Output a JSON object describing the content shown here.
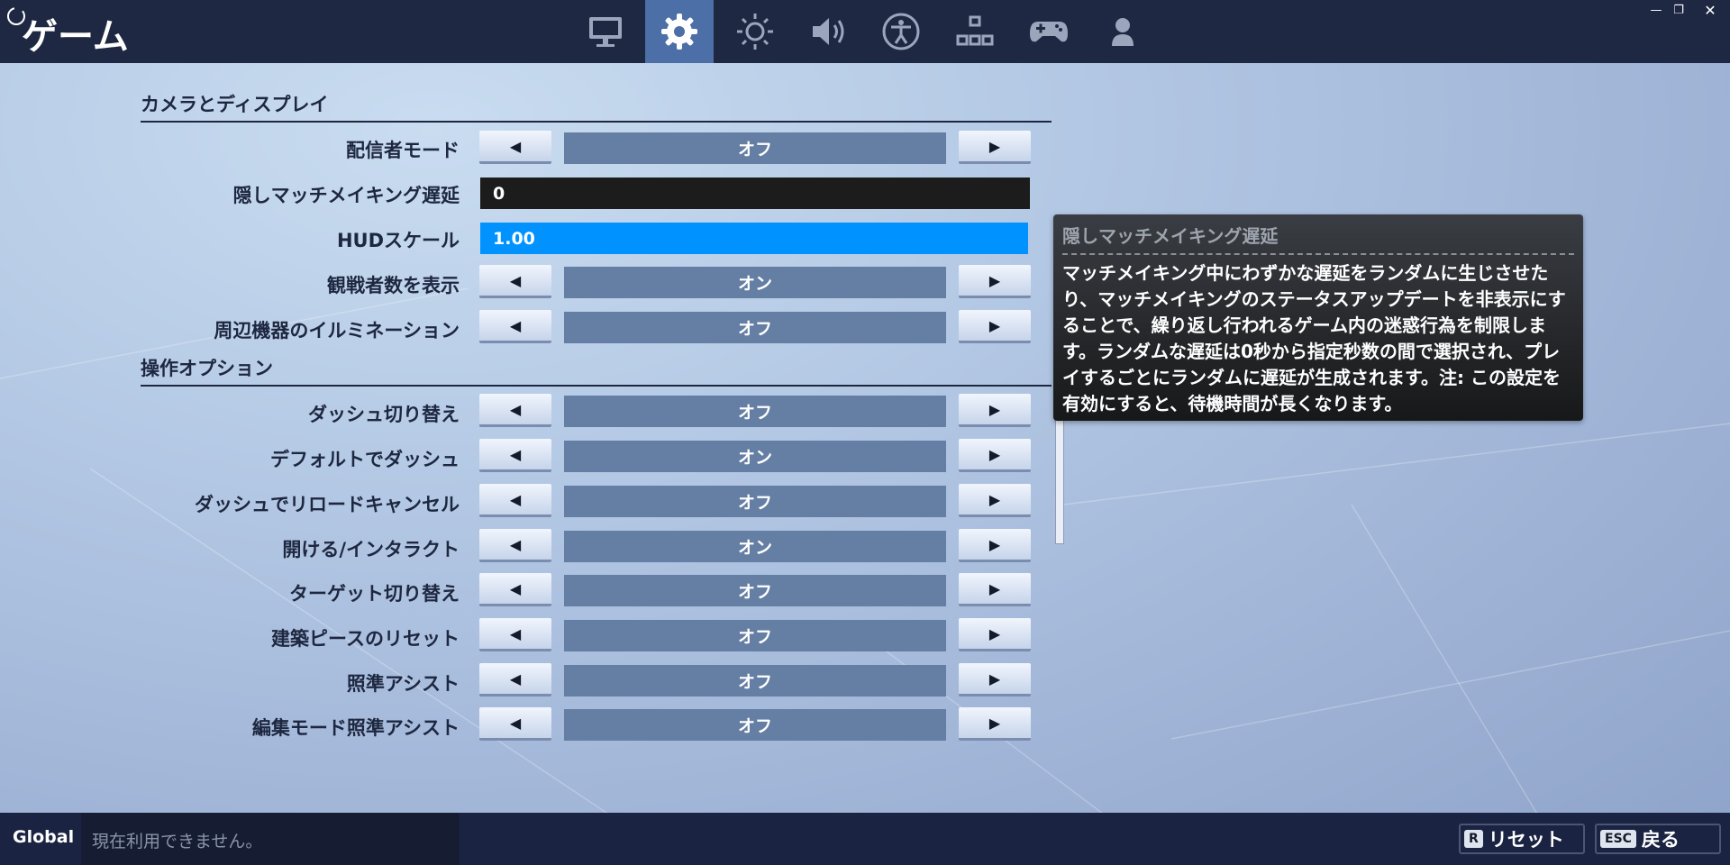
{
  "title": "ゲーム",
  "tabs": [
    {
      "icon": "monitor-icon",
      "active": false
    },
    {
      "icon": "gear-icon",
      "active": true
    },
    {
      "icon": "brightness-icon",
      "active": false
    },
    {
      "icon": "speaker-icon",
      "active": false
    },
    {
      "icon": "accessibility-icon",
      "active": false
    },
    {
      "icon": "input-tree-icon",
      "active": false
    },
    {
      "icon": "gamepad-icon",
      "active": false
    },
    {
      "icon": "account-icon",
      "active": false
    }
  ],
  "window": {
    "minimize": "—",
    "restore": "❐",
    "close": "✕"
  },
  "sections": {
    "camera": {
      "header": "カメラとディスプレイ",
      "rows": [
        {
          "label": "配信者モード",
          "value": "オフ"
        },
        {
          "label": "隠しマッチメイキング遅延",
          "value": "0"
        },
        {
          "label": "HUDスケール",
          "value": "1.00"
        },
        {
          "label": "観戦者数を表示",
          "value": "オン"
        },
        {
          "label": "周辺機器のイルミネーション",
          "value": "オフ"
        }
      ]
    },
    "controls": {
      "header": "操作オプション",
      "rows": [
        {
          "label": "ダッシュ切り替え",
          "value": "オフ"
        },
        {
          "label": "デフォルトでダッシュ",
          "value": "オン"
        },
        {
          "label": "ダッシュでリロードキャンセル",
          "value": "オフ"
        },
        {
          "label": "開ける/インタラクト",
          "value": "オン"
        },
        {
          "label": "ターゲット切り替え",
          "value": "オフ"
        },
        {
          "label": "建築ピースのリセット",
          "value": "オフ"
        },
        {
          "label": "照準アシスト",
          "value": "オフ"
        },
        {
          "label": "編集モード照準アシスト",
          "value": "オフ"
        }
      ]
    }
  },
  "arrows": {
    "left": "◀",
    "right": "▶"
  },
  "tooltip": {
    "title": "隠しマッチメイキング遅延",
    "body": "マッチメイキング中にわずかな遅延をランダムに生じさせたり、マッチメイキングのステータスアップデートを非表示にすることで、繰り返し行われるゲーム内の迷惑行為を制限します。ランダムな遅延は0秒から指定秒数の間で選択され、プレイするごとにランダムに遅延が生成されます。注: この設定を有効にすると、待機時間が長くなります。"
  },
  "footer": {
    "channel": "Global",
    "chat_placeholder": "現在利用できません。",
    "reset_key": "R",
    "reset_label": "リセット",
    "back_key": "ESC",
    "back_label": "戻る"
  }
}
